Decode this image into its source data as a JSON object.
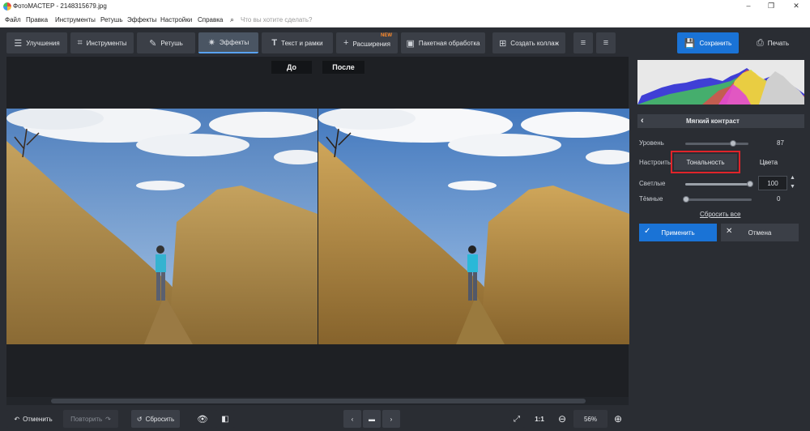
{
  "app": {
    "title": "ФотоМАСТЕР - 2148315679.jpg"
  },
  "menu": {
    "items": [
      "Файл",
      "Правка",
      "Инструменты",
      "Ретушь",
      "Эффекты",
      "Настройки",
      "Справка"
    ],
    "search_placeholder": "Что вы хотите сделать?"
  },
  "toolbar": {
    "tabs": [
      {
        "label": "Улучшения",
        "icon": "sliders-icon"
      },
      {
        "label": "Инструменты",
        "icon": "crop-icon"
      },
      {
        "label": "Ретушь",
        "icon": "brush-icon"
      },
      {
        "label": "Эффекты",
        "icon": "sparkle-icon"
      },
      {
        "label": "Текст и рамки",
        "icon": "text-icon"
      },
      {
        "label": "Расширения",
        "icon": "plus-icon",
        "badge": "NEW"
      },
      {
        "label": "Пакетная обработка",
        "icon": "batch-icon"
      },
      {
        "label": "Создать коллаж",
        "icon": "grid-icon"
      }
    ],
    "active_tab": "Эффекты",
    "save_label": "Сохранить",
    "print_label": "Печать"
  },
  "canvas": {
    "before_label": "До",
    "after_label": "После"
  },
  "bottom": {
    "undo_label": "Отменить",
    "redo_label": "Повторить",
    "reset_label": "Сбросить",
    "ratio_label": "1:1",
    "zoom_label": "56%"
  },
  "panel": {
    "title": "Мягкий контраст",
    "level_label": "Уровень",
    "level_value": "87",
    "adjust_label": "Настроить",
    "tonal_label": "Тональность",
    "colors_label": "Цвета",
    "light_label": "Светлые",
    "light_value": "100",
    "dark_label": "Тёмные",
    "dark_value": "0",
    "reset_all_label": "Сбросить все",
    "apply_label": "Применить",
    "cancel_label": "Отмена"
  },
  "colors": {
    "accent": "#1a73d6",
    "highlight": "#e0242a",
    "background": "#2a2d33"
  }
}
